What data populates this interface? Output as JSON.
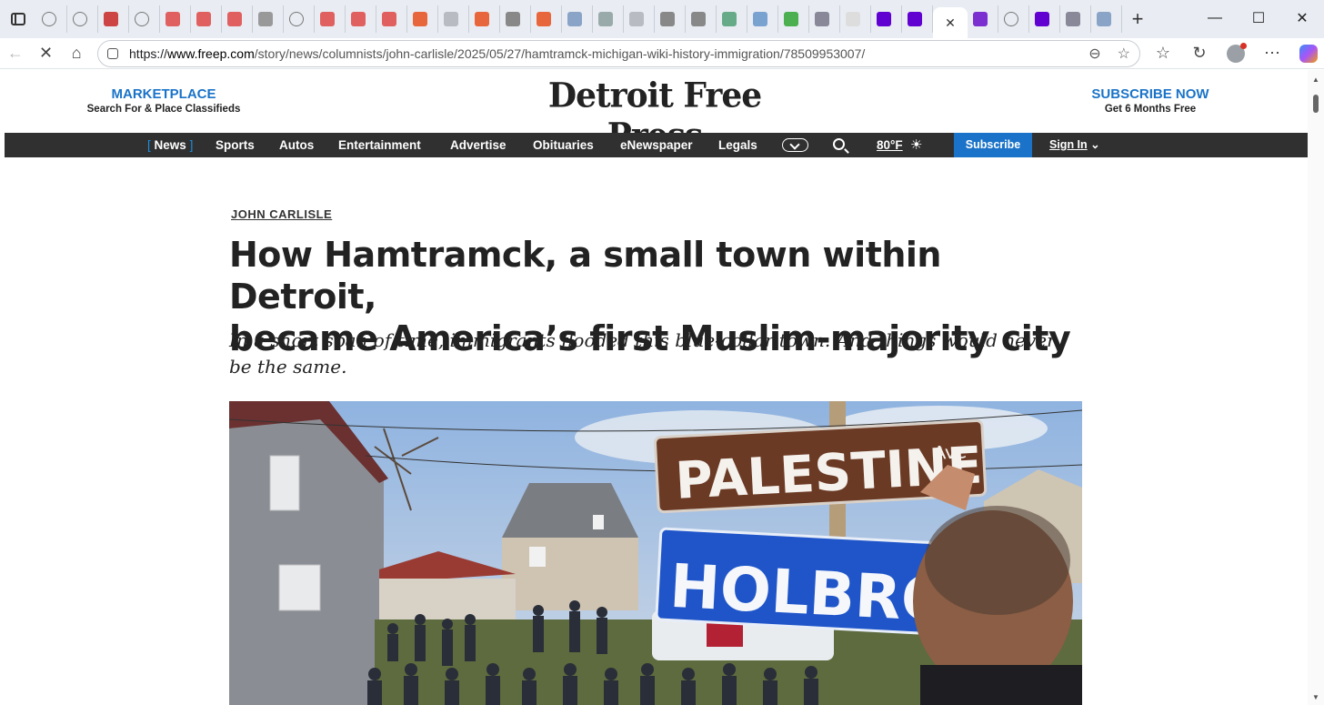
{
  "browser": {
    "tab_count_icons": [
      "globe",
      "globe",
      "news",
      "globe",
      "youtube",
      "youtube",
      "youtube",
      "logo",
      "globe",
      "youtube",
      "youtube",
      "youtube",
      "rss",
      "gp",
      "rss",
      "lock",
      "rss",
      "m",
      "bird",
      "gp",
      "circle",
      "circle",
      "gg",
      "plane",
      "green",
      "building",
      "google",
      "yahoo",
      "yahoo",
      "active",
      "mail",
      "globe",
      "yahoo",
      "cloud",
      "m"
    ],
    "active_tab_close": "✕",
    "new_tab": "+",
    "window_controls": {
      "minimize": "—",
      "maximize": "☐",
      "close": "✕"
    },
    "url": {
      "full": "https://www.freep.com/story/news/columnists/john-carlisle/2025/05/27/hamtramck-michigan-wiki-history-immigration/78509953007/",
      "prefix": "https://",
      "host": "www.freep.com",
      "path": "/story/news/columnists/john-carlisle/2025/05/27/hamtramck-michigan-wiki-history-immigration/78509953007/"
    },
    "colors": {
      "tab_bar": "#e9edf3",
      "accent": "#1a73c8"
    }
  },
  "site": {
    "marketplace": {
      "title": "MARKETPLACE",
      "subtitle": "Search For & Place Classifieds"
    },
    "logo_text": "Detroit Free Press",
    "subscribe_promo": {
      "title": "SUBSCRIBE NOW",
      "subtitle": "Get 6 Months Free"
    },
    "nav": {
      "items": [
        "News",
        "Sports",
        "Autos",
        "Entertainment",
        "Advertise",
        "Obituaries",
        "eNewspaper",
        "Legals"
      ],
      "active": "News",
      "temperature": "80°F",
      "subscribe_label": "Subscribe",
      "signin_label": "Sign In"
    }
  },
  "article": {
    "byline": "JOHN CARLISLE",
    "headline_line1": "How Hamtramck, a small town within Detroit,",
    "headline_line2": "became America’s first Muslim-majority city",
    "deck": "In a short span of time, immigrants flooded this blue-collar town. And things would never be the same.",
    "photo": {
      "sign_top": "PALESTINE",
      "sign_top_suffix": "Ave",
      "sign_bottom": "HOLBROO",
      "sign_top_color": "#6b3a24",
      "sign_bottom_color": "#1f55c9"
    }
  }
}
